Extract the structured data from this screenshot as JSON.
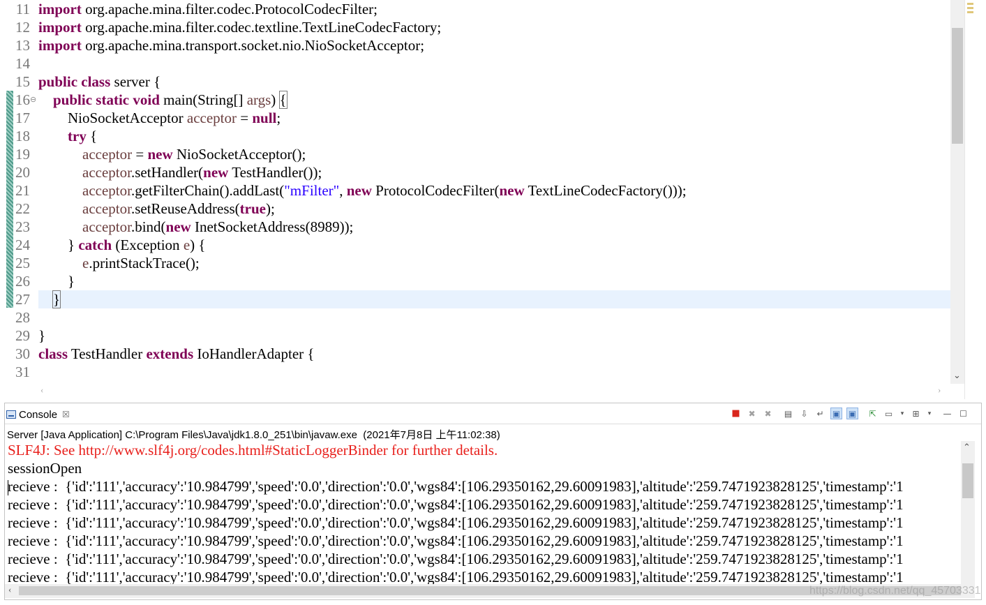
{
  "editor": {
    "lines": [
      {
        "no": "11",
        "seg": [
          [
            "kw",
            "import"
          ],
          [
            "t",
            " org.apache.mina.filter.codec.ProtocolCodecFilter;"
          ]
        ]
      },
      {
        "no": "12",
        "seg": [
          [
            "kw",
            "import"
          ],
          [
            "t",
            " org.apache.mina.filter.codec.textline.TextLineCodecFactory;"
          ]
        ]
      },
      {
        "no": "13",
        "seg": [
          [
            "kw",
            "import"
          ],
          [
            "t",
            " org.apache.mina.transport.socket.nio.NioSocketAcceptor;"
          ]
        ]
      },
      {
        "no": "14",
        "seg": []
      },
      {
        "no": "15",
        "seg": [
          [
            "kw",
            "public"
          ],
          [
            "t",
            " "
          ],
          [
            "kw",
            "class"
          ],
          [
            "t",
            " server {"
          ]
        ]
      },
      {
        "no": "16",
        "fold": true,
        "seg": [
          [
            "t",
            "    "
          ],
          [
            "kw",
            "public"
          ],
          [
            "t",
            " "
          ],
          [
            "kw",
            "static"
          ],
          [
            "t",
            " "
          ],
          [
            "kw",
            "void"
          ],
          [
            "t",
            " main(String[] "
          ],
          [
            "var",
            "args"
          ],
          [
            "t",
            ") "
          ],
          [
            "brk",
            "{"
          ]
        ]
      },
      {
        "no": "17",
        "seg": [
          [
            "t",
            "        NioSocketAcceptor "
          ],
          [
            "var",
            "acceptor"
          ],
          [
            "t",
            " = "
          ],
          [
            "kw",
            "null"
          ],
          [
            "t",
            ";"
          ]
        ]
      },
      {
        "no": "18",
        "seg": [
          [
            "t",
            "        "
          ],
          [
            "kw",
            "try"
          ],
          [
            "t",
            " {"
          ]
        ]
      },
      {
        "no": "19",
        "seg": [
          [
            "t",
            "            "
          ],
          [
            "var",
            "acceptor"
          ],
          [
            "t",
            " = "
          ],
          [
            "kw",
            "new"
          ],
          [
            "t",
            " NioSocketAcceptor();"
          ]
        ]
      },
      {
        "no": "20",
        "seg": [
          [
            "t",
            "            "
          ],
          [
            "var",
            "acceptor"
          ],
          [
            "t",
            ".setHandler("
          ],
          [
            "kw",
            "new"
          ],
          [
            "t",
            " TestHandler());"
          ]
        ]
      },
      {
        "no": "21",
        "seg": [
          [
            "t",
            "            "
          ],
          [
            "var",
            "acceptor"
          ],
          [
            "t",
            ".getFilterChain().addLast("
          ],
          [
            "str",
            "\"mFilter\""
          ],
          [
            "t",
            ", "
          ],
          [
            "kw",
            "new"
          ],
          [
            "t",
            " ProtocolCodecFilter("
          ],
          [
            "kw",
            "new"
          ],
          [
            "t",
            " TextLineCodecFactory()));"
          ]
        ]
      },
      {
        "no": "22",
        "seg": [
          [
            "t",
            "            "
          ],
          [
            "var",
            "acceptor"
          ],
          [
            "t",
            ".setReuseAddress("
          ],
          [
            "kw",
            "true"
          ],
          [
            "t",
            ");"
          ]
        ]
      },
      {
        "no": "23",
        "seg": [
          [
            "t",
            "            "
          ],
          [
            "var",
            "acceptor"
          ],
          [
            "t",
            ".bind("
          ],
          [
            "kw",
            "new"
          ],
          [
            "t",
            " InetSocketAddress(8989));"
          ]
        ]
      },
      {
        "no": "24",
        "seg": [
          [
            "t",
            "        } "
          ],
          [
            "kw",
            "catch"
          ],
          [
            "t",
            " (Exception "
          ],
          [
            "var",
            "e"
          ],
          [
            "t",
            ") {"
          ]
        ]
      },
      {
        "no": "25",
        "seg": [
          [
            "t",
            "            "
          ],
          [
            "var",
            "e"
          ],
          [
            "t",
            ".printStackTrace();"
          ]
        ]
      },
      {
        "no": "26",
        "seg": [
          [
            "t",
            "        }"
          ]
        ]
      },
      {
        "no": "27",
        "current": true,
        "seg": [
          [
            "t",
            "    "
          ],
          [
            "brk",
            "}"
          ]
        ]
      },
      {
        "no": "28",
        "seg": []
      },
      {
        "no": "29",
        "seg": [
          [
            "t",
            "}"
          ]
        ]
      },
      {
        "no": "30",
        "seg": [
          [
            "kw",
            "class"
          ],
          [
            "t",
            " TestHandler "
          ],
          [
            "kw",
            "extends"
          ],
          [
            "t",
            " IoHandlerAdapter {"
          ]
        ]
      },
      {
        "no": "31",
        "seg": []
      }
    ]
  },
  "console": {
    "tab_label": "Console",
    "tab_close": "☒",
    "process_label": "Server [Java Application] C:\\Program Files\\Java\\jdk1.8.0_251\\bin\\javaw.exe  (2021年7月8日 上午11:02:38)",
    "output": [
      {
        "type": "err",
        "text": "SLF4J: See http://www.slf4j.org/codes.html#StaticLoggerBinder for further details."
      },
      {
        "type": "out",
        "text": "sessionOpen"
      },
      {
        "type": "out",
        "text": "recieve :  {'id':'111','accuracy':'10.984799','speed':'0.0','direction':'0.0','wgs84':[106.29350162,29.60091983],'altitude':'259.7471923828125','timestamp':'1"
      },
      {
        "type": "out",
        "text": "recieve :  {'id':'111','accuracy':'10.984799','speed':'0.0','direction':'0.0','wgs84':[106.29350162,29.60091983],'altitude':'259.7471923828125','timestamp':'1"
      },
      {
        "type": "out",
        "text": "recieve :  {'id':'111','accuracy':'10.984799','speed':'0.0','direction':'0.0','wgs84':[106.29350162,29.60091983],'altitude':'259.7471923828125','timestamp':'1"
      },
      {
        "type": "out",
        "text": "recieve :  {'id':'111','accuracy':'10.984799','speed':'0.0','direction':'0.0','wgs84':[106.29350162,29.60091983],'altitude':'259.7471923828125','timestamp':'1"
      },
      {
        "type": "out",
        "text": "recieve :  {'id':'111','accuracy':'10.984799','speed':'0.0','direction':'0.0','wgs84':[106.29350162,29.60091983],'altitude':'259.7471923828125','timestamp':'1"
      },
      {
        "type": "out",
        "text": "recieve :  {'id':'111','accuracy':'10.984799','speed':'0.0','direction':'0.0','wgs84':[106.29350162,29.60091983],'altitude':'259.7471923828125','timestamp':'1"
      }
    ],
    "toolbar": [
      {
        "name": "terminate-icon",
        "glyph": "■",
        "cls": "terminate"
      },
      {
        "name": "remove-launch-icon",
        "glyph": "✖",
        "cls": "gray"
      },
      {
        "name": "remove-all-terminated-icon",
        "glyph": "✖",
        "cls": "gray"
      },
      {
        "name": "clear-console-icon",
        "glyph": "▤",
        "cls": ""
      },
      {
        "name": "scroll-lock-icon",
        "glyph": "⇩",
        "cls": ""
      },
      {
        "name": "word-wrap-icon",
        "glyph": "↵",
        "cls": ""
      },
      {
        "name": "show-on-stdout-icon",
        "glyph": "▣",
        "cls": "pressed blue"
      },
      {
        "name": "show-on-stderr-icon",
        "glyph": "▣",
        "cls": "pressed blue"
      },
      {
        "name": "pin-console-icon",
        "glyph": "⇱",
        "cls": "green"
      },
      {
        "name": "display-console-icon",
        "glyph": "▭",
        "cls": ""
      },
      {
        "name": "display-console-menu-icon",
        "glyph": "▾",
        "cls": "small"
      },
      {
        "name": "open-console-icon",
        "glyph": "⊞",
        "cls": ""
      },
      {
        "name": "open-console-menu-icon",
        "glyph": "▾",
        "cls": "small"
      },
      {
        "name": "minimize-icon",
        "glyph": "—",
        "cls": ""
      },
      {
        "name": "maximize-icon",
        "glyph": "☐",
        "cls": ""
      }
    ]
  },
  "watermark": "https://blog.csdn.net/qq_45703331"
}
